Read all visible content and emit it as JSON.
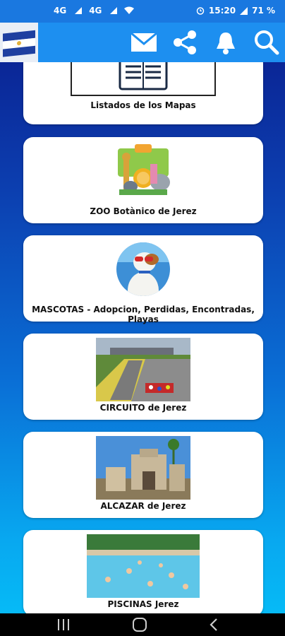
{
  "status_bar": {
    "network1": "4G",
    "network2": "4G",
    "time": "15:20",
    "battery": "71 %"
  },
  "app_bar": {
    "icons": [
      "flag-icon",
      "mail-icon",
      "share-icon",
      "bell-icon",
      "search-icon"
    ]
  },
  "cards": [
    {
      "label": "Listados de los Mapas",
      "icon": "map-list-icon"
    },
    {
      "label": "ZOO Botànico de Jerez",
      "icon": "zoo-animals-image"
    },
    {
      "label": "MASCOTAS - Adopcion, Perdidas, Encontradas, Playas",
      "icon": "dog-with-sunglasses-image"
    },
    {
      "label": "CIRCUITO de Jerez",
      "icon": "race-circuit-image"
    },
    {
      "label": "ALCAZAR de Jerez",
      "icon": "alcazar-castle-image"
    },
    {
      "label": "PISCINAS Jerez",
      "icon": "swimming-pool-image"
    }
  ],
  "colors": {
    "status_bar": "#1a78e0",
    "app_bar": "#1d8ff0",
    "background_top": "#0a1a8a",
    "background_bottom": "#05c0f8"
  }
}
